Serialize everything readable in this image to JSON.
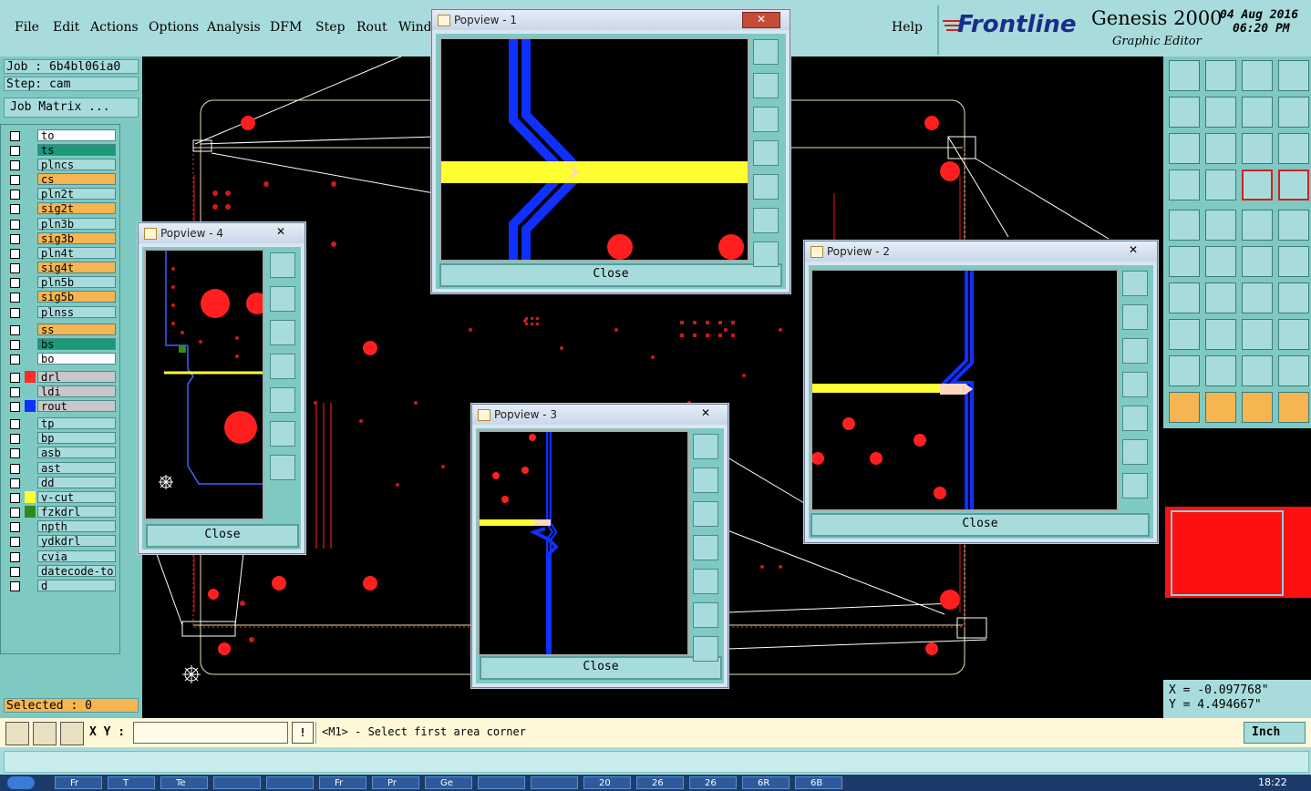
{
  "menubar": {
    "items": [
      "File",
      "Edit",
      "Actions",
      "Options",
      "Analysis",
      "DFM",
      "Step",
      "Rout",
      "Wind"
    ],
    "help": "Help",
    "brand": "Frontline",
    "product": "Genesis 2000",
    "subtitle": "Graphic Editor",
    "date": "04 Aug 2016",
    "time": "06:20 PM"
  },
  "job": {
    "job_label": "Job : 6b4bl06ia0",
    "step_label": "Step: cam",
    "matrix_button": "Job Matrix ..."
  },
  "layers": [
    {
      "name": "to",
      "color": "#ffffff",
      "swatch": "",
      "mark": true
    },
    {
      "name": "ts",
      "color": "#1a9a7a",
      "swatch": ""
    },
    {
      "name": "plncs",
      "color": "#a8dcdc",
      "swatch": ""
    },
    {
      "name": "cs",
      "color": "#f6b550",
      "swatch": ""
    },
    {
      "name": "pln2t",
      "color": "#a8dcdc",
      "swatch": ""
    },
    {
      "name": "sig2t",
      "color": "#f6b550",
      "swatch": "",
      "mark": true
    },
    {
      "name": "pln3b",
      "color": "#a8dcdc",
      "swatch": ""
    },
    {
      "name": "sig3b",
      "color": "#f6b550",
      "swatch": ""
    },
    {
      "name": "pln4t",
      "color": "#a8dcdc",
      "swatch": ""
    },
    {
      "name": "sig4t",
      "color": "#f6b550",
      "swatch": ""
    },
    {
      "name": "pln5b",
      "color": "#a8dcdc",
      "swatch": ""
    },
    {
      "name": "sig5b",
      "color": "#f6b550",
      "swatch": ""
    },
    {
      "name": "plnss",
      "color": "#a8dcdc",
      "swatch": ""
    },
    {
      "name": "ss",
      "color": "#f6b550",
      "swatch": ""
    },
    {
      "name": "bs",
      "color": "#1a9a7a",
      "swatch": ""
    },
    {
      "name": "bo",
      "color": "#ffffff",
      "swatch": "",
      "mark": true
    },
    {
      "name": "drl",
      "color": "#c8c8c8",
      "swatch": "#ff2a2a"
    },
    {
      "name": "ldi",
      "color": "#c8c8c8",
      "swatch": ""
    },
    {
      "name": "rout",
      "color": "#c8c8c8",
      "swatch": "#1030ff"
    },
    {
      "name": "tp",
      "color": "#a8dcdc",
      "swatch": ""
    },
    {
      "name": "bp",
      "color": "#a8dcdc",
      "swatch": ""
    },
    {
      "name": "asb",
      "color": "#a8dcdc",
      "swatch": "",
      "mark": true
    },
    {
      "name": "ast",
      "color": "#a8dcdc",
      "swatch": "",
      "mark": true
    },
    {
      "name": "dd",
      "color": "#a8dcdc",
      "swatch": ""
    },
    {
      "name": "v-cut",
      "color": "#a8dcdc",
      "swatch": "#ffff30"
    },
    {
      "name": "fzkdrl",
      "color": "#a8dcdc",
      "swatch": "#2f8a1f"
    },
    {
      "name": "npth",
      "color": "#a8dcdc",
      "swatch": ""
    },
    {
      "name": "ydkdrl",
      "color": "#a8dcdc",
      "swatch": ""
    },
    {
      "name": "cvia",
      "color": "#a8dcdc",
      "swatch": ""
    },
    {
      "name": "datecode-to",
      "color": "#a8dcdc",
      "swatch": ""
    },
    {
      "name": "d",
      "color": "#a8dcdc",
      "swatch": ""
    }
  ],
  "selected": "Selected : 0",
  "popviews": {
    "p1": {
      "title": "Popview - 1",
      "close": "Close"
    },
    "p2": {
      "title": "Popview - 2",
      "close": "Close"
    },
    "p3": {
      "title": "Popview - 3",
      "close": "Close"
    },
    "p4": {
      "title": "Popview - 4",
      "close": "Close"
    },
    "close_x": "✕"
  },
  "coords": {
    "x": "X = -0.097768\"",
    "y": "Y = 4.494667\""
  },
  "status": {
    "xy_label": "X Y :",
    "xy_value": "",
    "prompt": "<M1> - Select first area corner",
    "units": "Inch",
    "warn": "!"
  },
  "taskbar": {
    "items": [
      "Fr",
      "T",
      "Te",
      "",
      "",
      "Fr",
      "Pr",
      "Ge",
      "",
      "",
      "20",
      "26",
      "26",
      "6R",
      "6B"
    ],
    "clock": "18:22"
  }
}
